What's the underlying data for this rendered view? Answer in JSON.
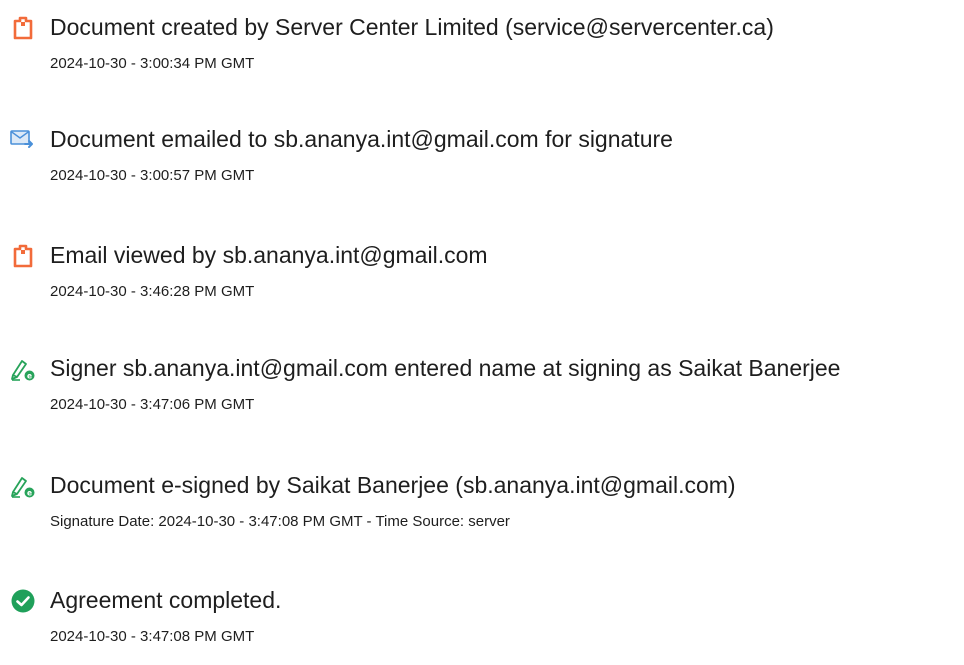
{
  "events": [
    {
      "icon": "document-created-icon",
      "title": "Document created by Server Center Limited (service@servercenter.ca)",
      "meta": "2024-10-30 - 3:00:34 PM GMT"
    },
    {
      "icon": "email-sent-icon",
      "title": "Document emailed to sb.ananya.int@gmail.com for signature",
      "meta": "2024-10-30 - 3:00:57 PM GMT"
    },
    {
      "icon": "email-viewed-icon",
      "title": "Email viewed by sb.ananya.int@gmail.com",
      "meta": "2024-10-30 - 3:46:28 PM GMT"
    },
    {
      "icon": "signer-name-icon",
      "title": "Signer sb.ananya.int@gmail.com entered name at signing as Saikat Banerjee",
      "meta": "2024-10-30 - 3:47:06 PM GMT"
    },
    {
      "icon": "e-signed-icon",
      "title": "Document e-signed by Saikat Banerjee (sb.ananya.int@gmail.com)",
      "meta": "Signature Date: 2024-10-30 - 3:47:08 PM GMT - Time Source: server"
    },
    {
      "icon": "completed-check-icon",
      "title": "Agreement completed.",
      "meta": "2024-10-30 - 3:47:08 PM GMT"
    }
  ],
  "colors": {
    "document_icon": "#f26b3a",
    "email_icon": "#4a90d9",
    "pen_icon": "#27a35a",
    "check_icon": "#1fa05a",
    "text": "#1e1e1e"
  }
}
